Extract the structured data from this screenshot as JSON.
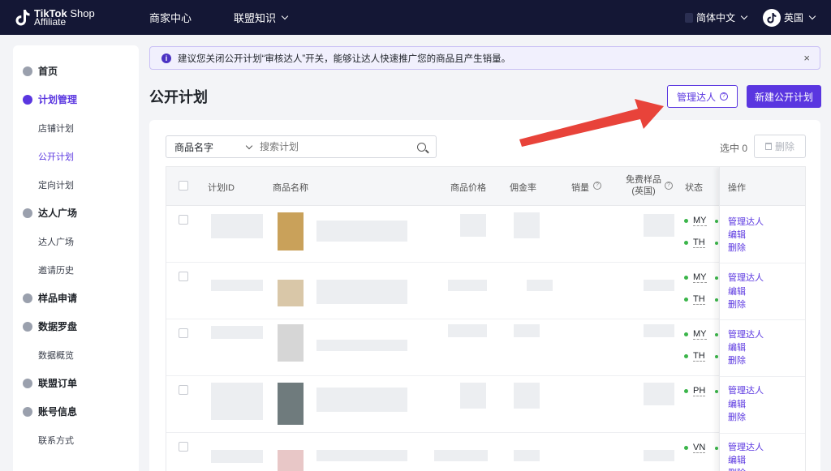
{
  "brand": {
    "name": "TikTok",
    "shop": "Shop",
    "sub": "Affiliate"
  },
  "topnav": {
    "seller_center": "商家中心",
    "alliance_knowledge": "联盟知识",
    "language": "简体中文",
    "region": "英国"
  },
  "sidebar": {
    "home": "首页",
    "plan_mgmt": "计划管理",
    "shop_plan": "店铺计划",
    "open_plan": "公开计划",
    "targeted_plan": "定向计划",
    "creator_square": "达人广场",
    "creator_square_sub": "达人广场",
    "invite_history": "邀请历史",
    "sample_request": "样品申请",
    "data_compass": "数据罗盘",
    "data_overview": "数据概览",
    "alliance_orders": "联盟订单",
    "account_info": "账号信息",
    "contact": "联系方式"
  },
  "banner": {
    "icon": "i",
    "text": "建议您关闭公开计划“审核达人”开关，能够让达人快速推广您的商品且产生销量。",
    "close": "×"
  },
  "page": {
    "title": "公开计划",
    "manage_btn": "管理达人",
    "manage_help": "?",
    "new_btn": "新建公开计划"
  },
  "search": {
    "select_value": "商品名字",
    "placeholder": "搜索计划"
  },
  "selection": {
    "label": "选中 0",
    "delete": "删除"
  },
  "table": {
    "headers": {
      "plan_id": "计划ID",
      "product_name": "商品名称",
      "price": "商品价格",
      "commission": "佣金率",
      "sales": "销量",
      "free_sample_1": "免费样品",
      "free_sample_2": "(英国)",
      "status": "状态",
      "ops": "操作"
    },
    "rows": [
      {
        "countries": [
          "MY",
          "TH"
        ],
        "ops": [
          "管理达人",
          "编辑",
          "删除"
        ]
      },
      {
        "countries": [
          "MY",
          "TH"
        ],
        "ops": [
          "管理达人",
          "编辑",
          "删除"
        ]
      },
      {
        "countries": [
          "MY",
          "TH"
        ],
        "ops": [
          "管理达人",
          "编辑",
          "删除"
        ]
      },
      {
        "countries": [
          "PH"
        ],
        "ops": [
          "管理达人",
          "编辑",
          "删除"
        ]
      },
      {
        "countries": [
          "VN"
        ],
        "ops": [
          "管理达人",
          "编辑",
          "删除"
        ]
      }
    ]
  },
  "colors": {
    "nav_bg": "#141735",
    "accent": "#5a36e0",
    "annotation_arrow": "#e8433a",
    "status_dot": "#3bb54a"
  },
  "icons": [
    "tiktok-logo-icon",
    "chevron-down-icon",
    "globe-icon",
    "info-icon",
    "close-icon",
    "help-icon",
    "search-icon",
    "trash-icon",
    "red-arrow-annotation"
  ]
}
